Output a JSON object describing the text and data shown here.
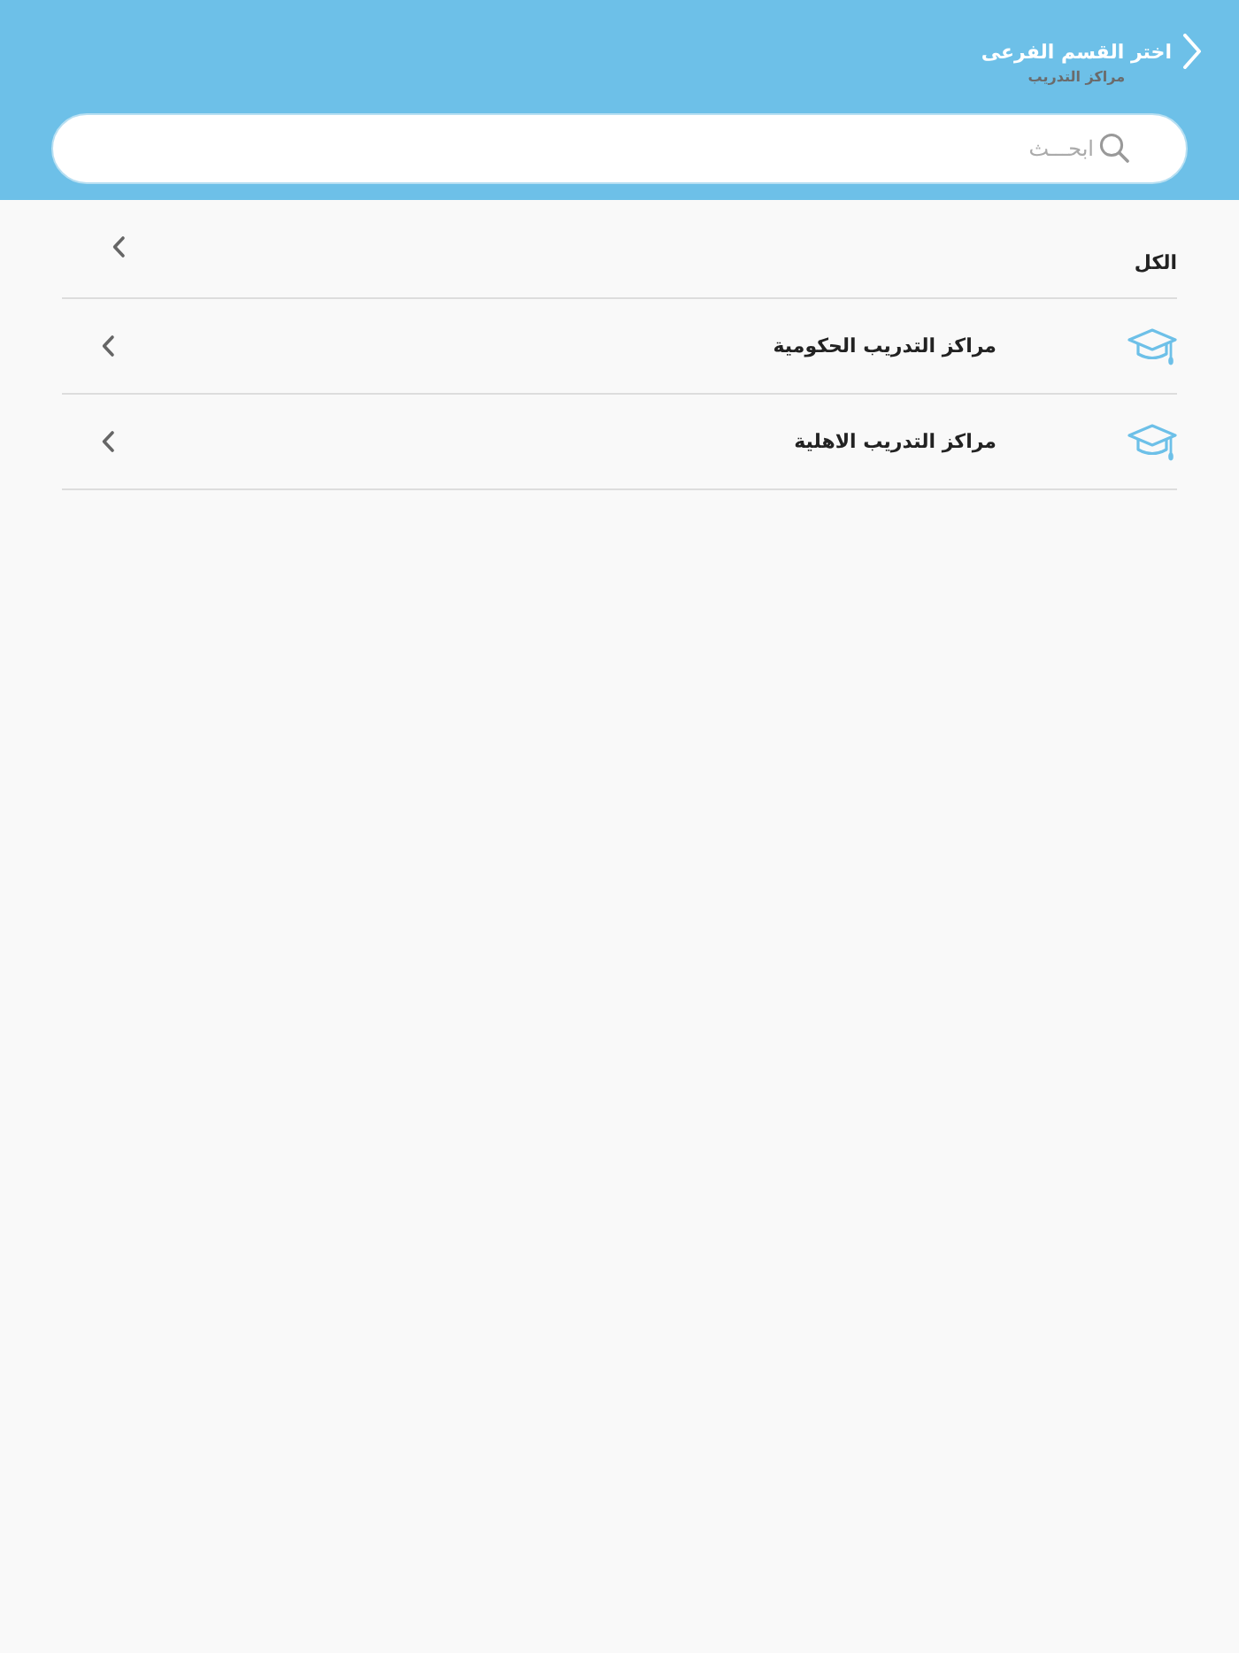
{
  "header": {
    "title": "اختر القسم الفرعى",
    "subtitle": "مراكز التدريب"
  },
  "search": {
    "placeholder": "ابحـــث"
  },
  "items": [
    {
      "kind": "plain",
      "label": "الكل"
    },
    {
      "kind": "category",
      "label": "مراكز التدريب الحكومية"
    },
    {
      "kind": "category",
      "label": "مراكز التدريب الاهلية"
    }
  ]
}
